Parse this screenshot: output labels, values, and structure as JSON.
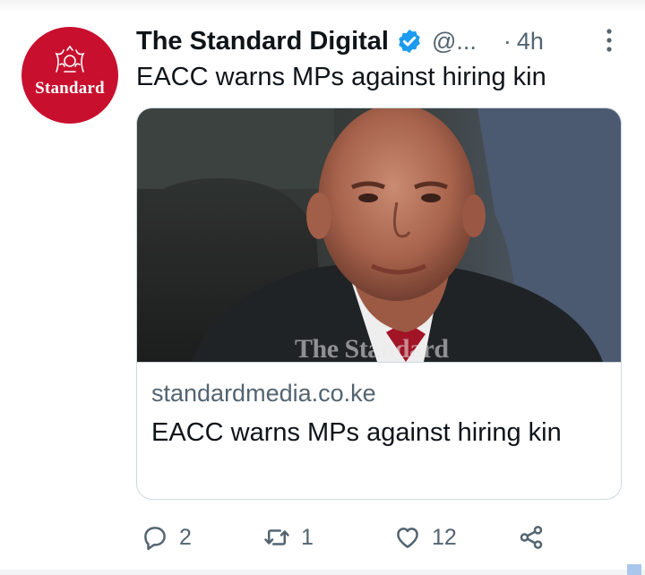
{
  "tweet": {
    "avatar_text": "Standard",
    "display_name": "The Standard Digital",
    "handle": "@...",
    "dot": "·",
    "time": "4h",
    "text": "EACC warns MPs against hiring kin"
  },
  "card": {
    "watermark": "The Standard",
    "domain": "standardmedia.co.ke",
    "title": "EACC warns MPs against hiring kin"
  },
  "actions": {
    "reply_count": "2",
    "retweet_count": "1",
    "like_count": "12"
  },
  "icons": {
    "verified": "verified-badge-icon",
    "more": "more-icon",
    "reply": "reply-icon",
    "retweet": "retweet-icon",
    "like": "heart-icon",
    "share": "share-icon"
  },
  "colors": {
    "brand_red": "#c8102e",
    "verified_blue": "#1d9bf0",
    "secondary_text": "#536471",
    "primary_text": "#0f1419",
    "border": "#cfd9de"
  }
}
